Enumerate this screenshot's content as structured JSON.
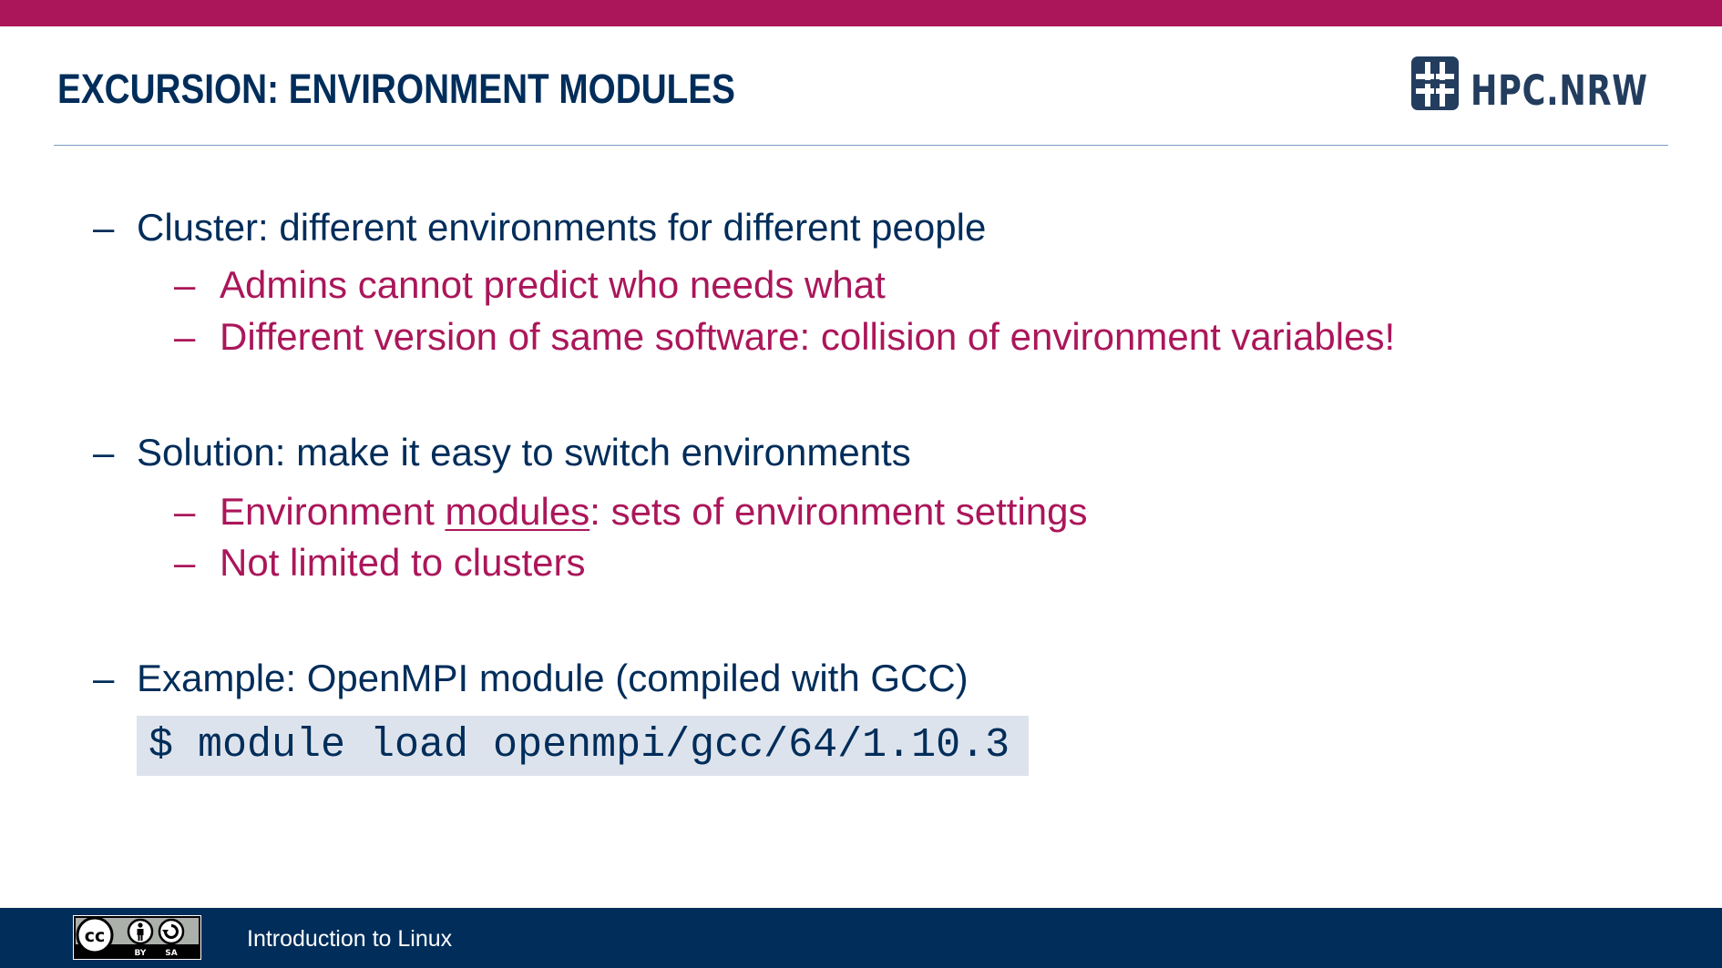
{
  "header": {
    "title": "EXCURSION: ENVIRONMENT MODULES",
    "logo_text": "HPC.NRW",
    "logo_mark": "hash-icon"
  },
  "bullets": [
    {
      "marker": "–",
      "label": "Cluster:",
      "text": "different environments for different people",
      "sub": [
        {
          "marker": "–",
          "text": "Admins cannot predict who needs what"
        },
        {
          "marker": "–",
          "label": "Different version of same software:",
          "text": "collision of environment variables!"
        }
      ]
    },
    {
      "marker": "–",
      "label": "Solution:",
      "text": "make it easy to switch environments",
      "sub": [
        {
          "marker": "–",
          "pre": "Environment ",
          "link": "modules",
          "post": ":",
          "text": "sets of environment settings"
        },
        {
          "marker": "–",
          "text": "Not limited to clusters"
        }
      ]
    },
    {
      "marker": "–",
      "label": "Example:",
      "text": "OpenMPI module (compiled with GCC)"
    }
  ],
  "code": "$ module load openmpi/gcc/64/1.10.3",
  "footer": {
    "text": "Introduction to Linux",
    "license": {
      "icons": [
        "cc-icon",
        "by-icon",
        "sa-icon"
      ],
      "labels": [
        "BY",
        "SA"
      ]
    }
  },
  "colors": {
    "accent": "#ab165a",
    "primary": "#002d5a",
    "code_bg": "#dde3ec",
    "rule": "#7a9cc0"
  }
}
